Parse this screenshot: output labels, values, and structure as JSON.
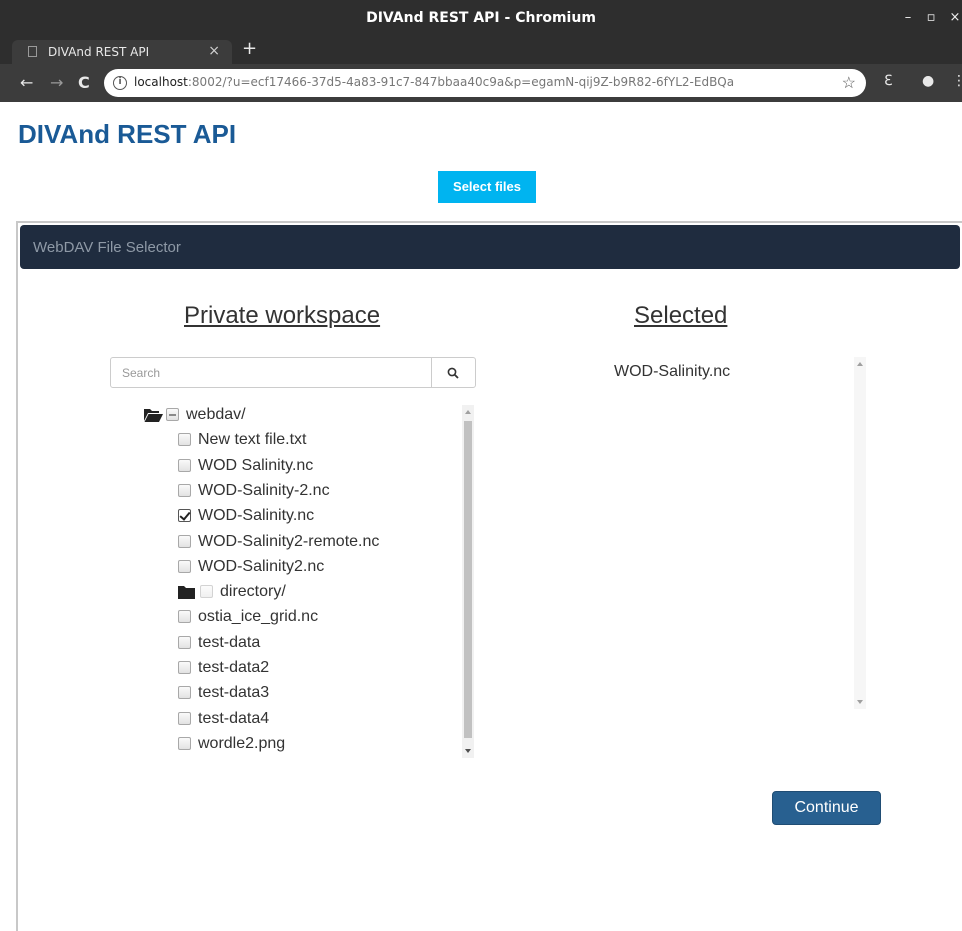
{
  "window": {
    "title": "DIVAnd REST API - Chromium",
    "controls": {
      "minimize": "–",
      "maximize": "▫",
      "close": "×"
    }
  },
  "tab": {
    "label": "DIVAnd REST API",
    "close": "×",
    "new_tab": "+"
  },
  "toolbar": {
    "back": "←",
    "forward": "→",
    "reload": "C",
    "info": "i",
    "url_host": "localhost",
    "url_rest": ":8002/?u=ecf17466-37d5-4a83-91c7-847bbaa40c9a&p=egamN-qij9Z-b9R82-6fYL2-EdBQa",
    "star": "☆",
    "ext1": "ℇ",
    "ext2": "●",
    "menu": "⋮"
  },
  "page": {
    "title": "DIVAnd REST API",
    "select_files_label": "Select files"
  },
  "modal": {
    "header": "WebDAV File Selector",
    "private_title": "Private workspace",
    "selected_title": "Selected",
    "search_placeholder": "Search",
    "continue_label": "Continue",
    "selected_items": [
      "WOD-Salinity.nc"
    ],
    "tree": [
      {
        "label": "webdav/",
        "type": "folder-open",
        "state": "partial",
        "level": 0
      },
      {
        "label": "New text file.txt",
        "type": "file",
        "state": "unchecked",
        "level": 1
      },
      {
        "label": "WOD Salinity.nc",
        "type": "file",
        "state": "unchecked",
        "level": 1
      },
      {
        "label": "WOD-Salinity-2.nc",
        "type": "file",
        "state": "unchecked",
        "level": 1
      },
      {
        "label": "WOD-Salinity.nc",
        "type": "file",
        "state": "checked",
        "level": 1
      },
      {
        "label": "WOD-Salinity2-remote.nc",
        "type": "file",
        "state": "unchecked",
        "level": 1
      },
      {
        "label": "WOD-Salinity2.nc",
        "type": "file",
        "state": "unchecked",
        "level": 1
      },
      {
        "label": "directory/",
        "type": "folder-closed",
        "state": "disabled",
        "level": 1
      },
      {
        "label": "ostia_ice_grid.nc",
        "type": "file",
        "state": "unchecked",
        "level": 1
      },
      {
        "label": "test-data",
        "type": "file",
        "state": "unchecked",
        "level": 1
      },
      {
        "label": "test-data2",
        "type": "file",
        "state": "unchecked",
        "level": 1
      },
      {
        "label": "test-data3",
        "type": "file",
        "state": "unchecked",
        "level": 1
      },
      {
        "label": "test-data4",
        "type": "file",
        "state": "unchecked",
        "level": 1
      },
      {
        "label": "wordle2.png",
        "type": "file",
        "state": "unchecked",
        "level": 1
      }
    ]
  },
  "colors": {
    "title_blue": "#1a5a96",
    "select_button": "#00b4f0",
    "modal_header": "#1f2c3f",
    "continue_button": "#286090"
  }
}
